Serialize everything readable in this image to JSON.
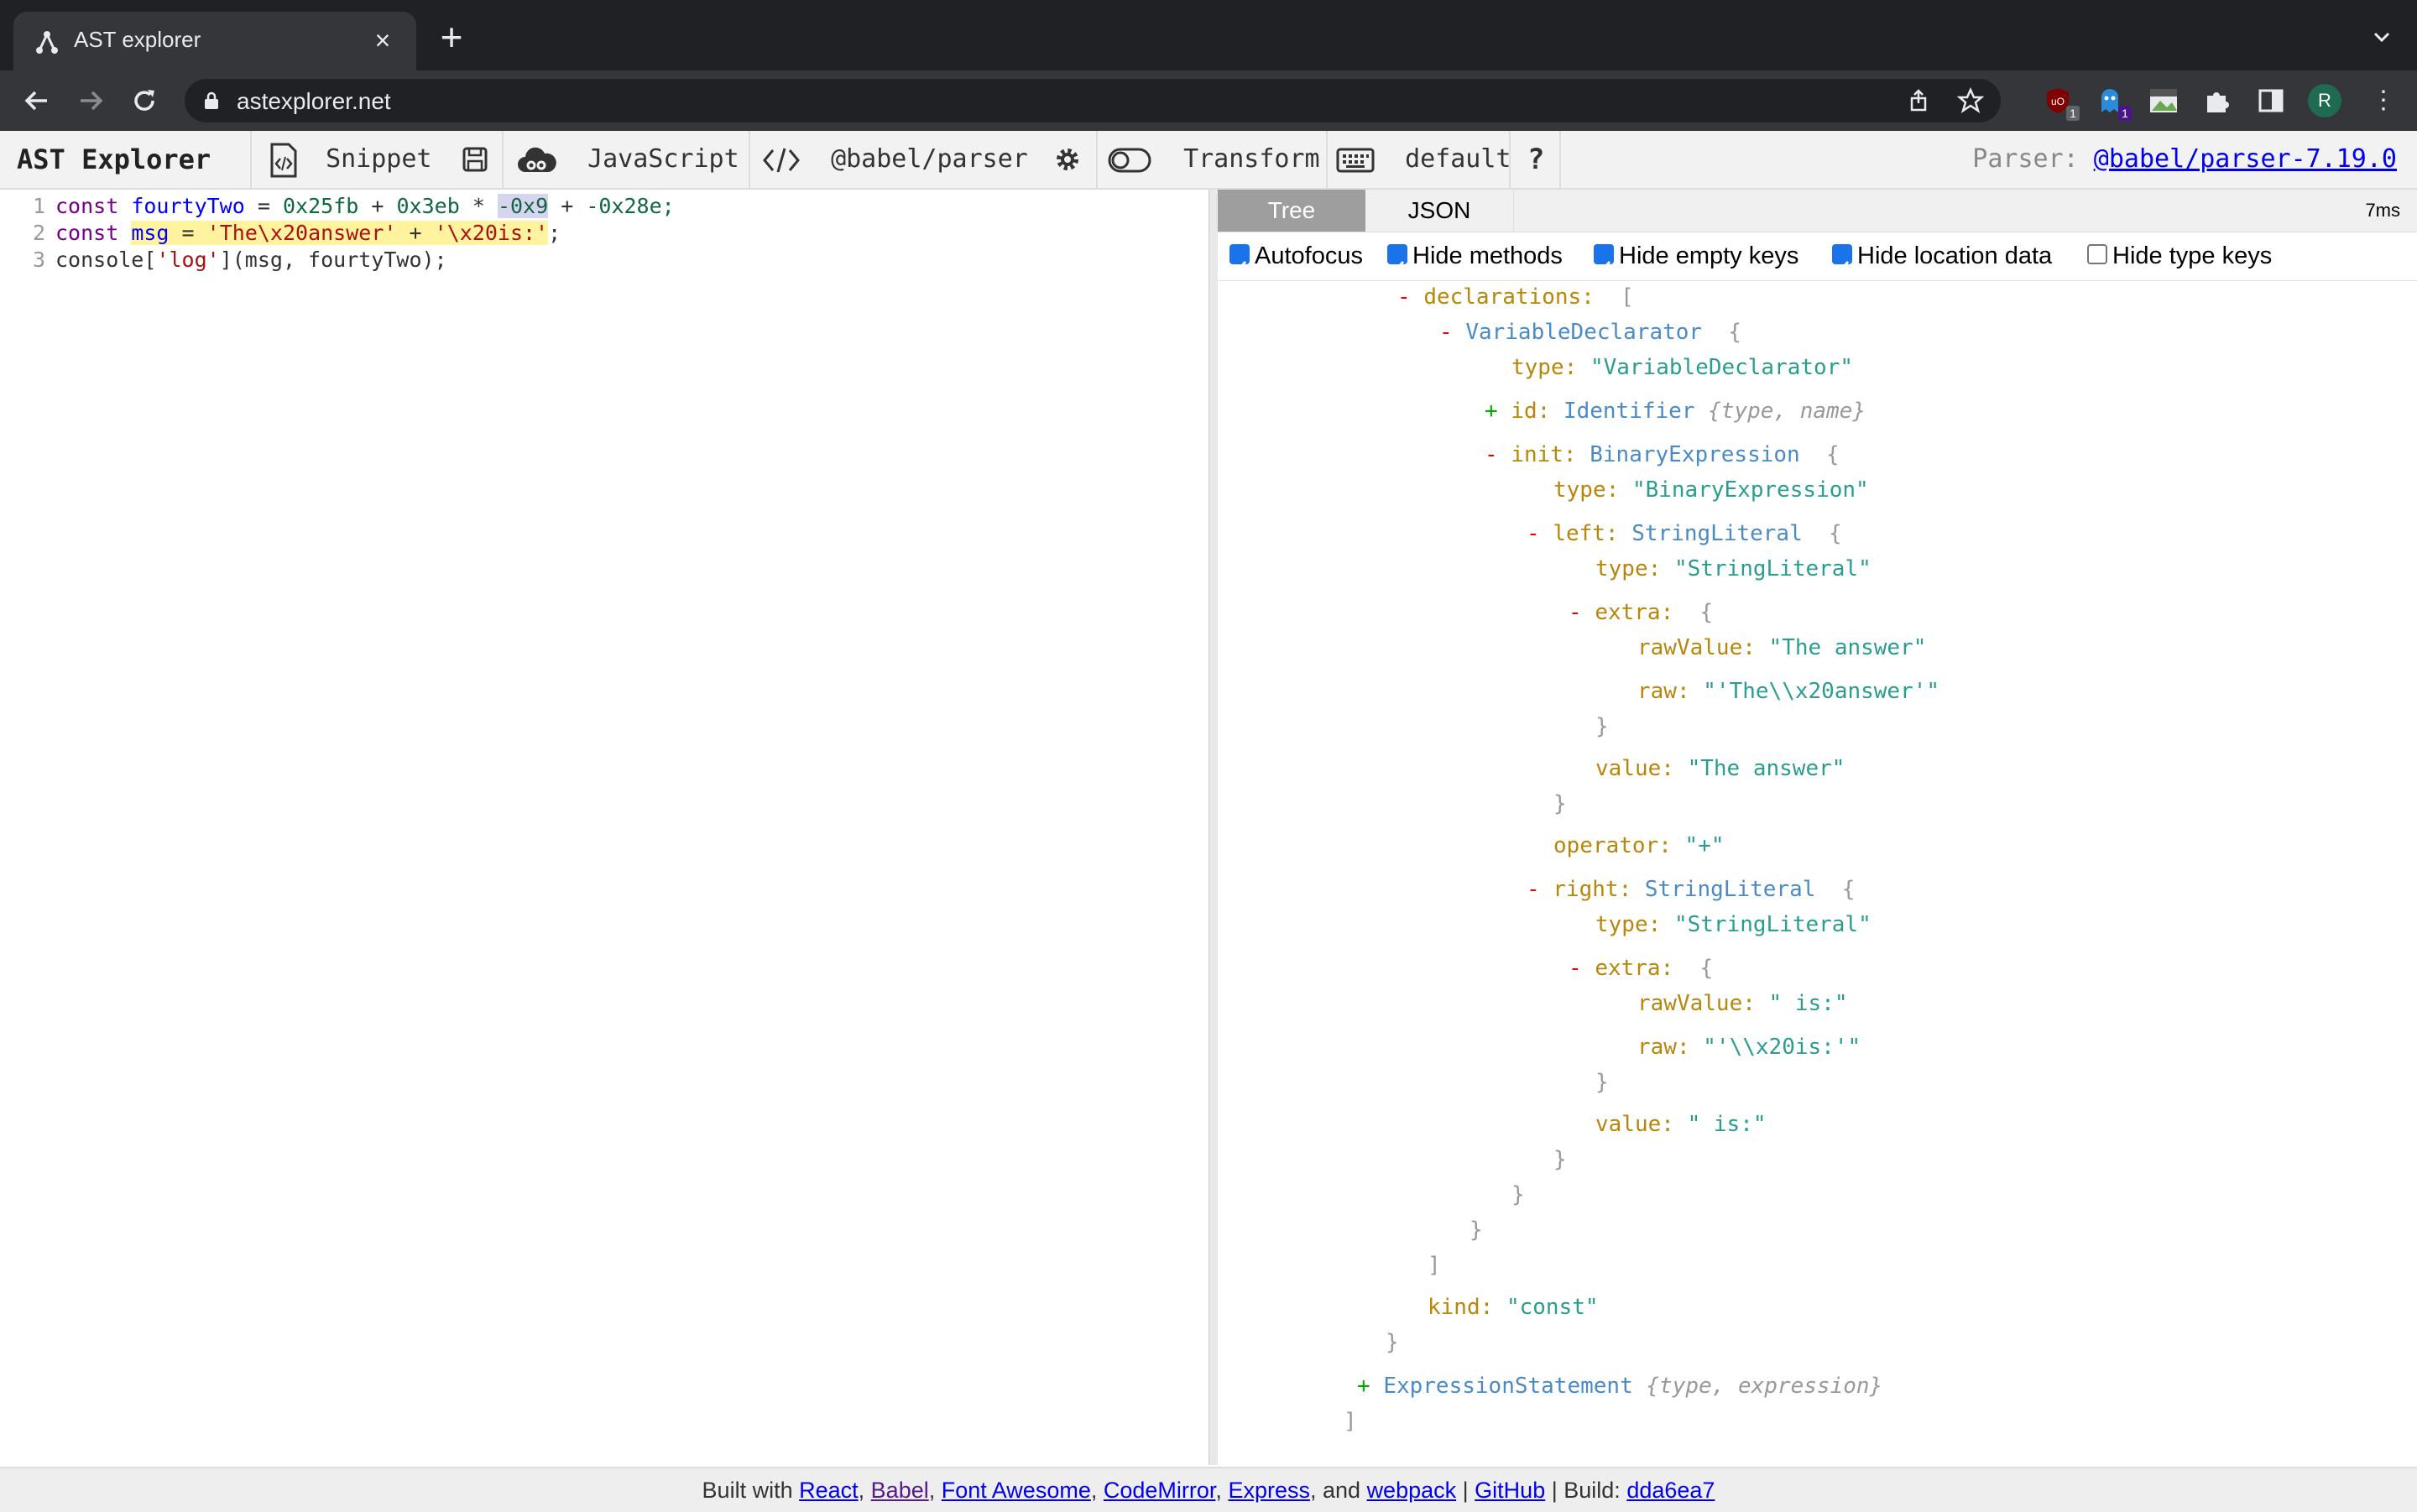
{
  "browser": {
    "tab_title": "AST explorer",
    "url": "astexplorer.net",
    "avatar_letter": "R",
    "ext_badge_1": "1",
    "ext_badge_2": "1"
  },
  "appbar": {
    "brand": "AST Explorer",
    "snippet": "Snippet",
    "language": "JavaScript",
    "parser": "@babel/parser",
    "transform": "Transform",
    "keymap": "default",
    "help": "?",
    "parser_label": "Parser:",
    "parser_version": "@babel/parser-7.19.0"
  },
  "editor": {
    "lines": [
      {
        "num": "1",
        "t": [
          "const",
          "fourtyTwo",
          "=",
          "0x25fb",
          "+",
          "0x3eb",
          "*",
          "-0x9",
          "+",
          "-0x28e;"
        ]
      },
      {
        "num": "2",
        "t": [
          "const",
          "msg",
          "=",
          "'The\\x20answer'",
          "+",
          "'\\x20is:'",
          ";"
        ]
      },
      {
        "num": "3",
        "t": [
          "console[",
          "'log'",
          "](msg, fourtyTwo);"
        ]
      }
    ]
  },
  "output": {
    "tabs": [
      "Tree",
      "JSON"
    ],
    "timing": "7ms",
    "options": [
      {
        "label": "Autofocus",
        "checked": true
      },
      {
        "label": "Hide methods",
        "checked": true
      },
      {
        "label": "Hide empty keys",
        "checked": true
      },
      {
        "label": "Hide location data",
        "checked": true
      },
      {
        "label": "Hide type keys",
        "checked": false
      }
    ]
  },
  "tree": {
    "declarations": "declarations:",
    "VariableDeclarator": "VariableDeclarator",
    "type_key": "type:",
    "VariableDeclarator_str": "\"VariableDeclarator\"",
    "id": "id:",
    "Identifier": "Identifier",
    "id_summary": "{type, name}",
    "init": "init:",
    "BinaryExpression": "BinaryExpression",
    "BinaryExpression_str": "\"BinaryExpression\"",
    "left": "left:",
    "StringLiteral": "StringLiteral",
    "StringLiteral_str": "\"StringLiteral\"",
    "extra": "extra:",
    "rawValue": "rawValue:",
    "raw": "raw:",
    "value": "value:",
    "left_rawValue": "\"The answer\"",
    "left_raw": "\"'The\\\\x20answer'\"",
    "left_value": "\"The answer\"",
    "operator": "operator:",
    "operator_val": "\"+\"",
    "right": "right:",
    "right_rawValue": "\" is:\"",
    "right_raw": "\"'\\\\x20is:'\"",
    "right_value": "\" is:\"",
    "kind": "kind:",
    "kind_val": "\"const\"",
    "ExpressionStatement": "ExpressionStatement",
    "es_summary": "{type, expression}"
  },
  "footer": {
    "built_with": "Built with",
    "react": "React",
    "babel": "Babel",
    "fontawesome": "Font Awesome",
    "codemirror": "CodeMirror",
    "express": "Express",
    "and": ", and",
    "webpack": "webpack",
    "github": "GitHub",
    "build_label": "| Build:",
    "build": "dda6ea7"
  }
}
